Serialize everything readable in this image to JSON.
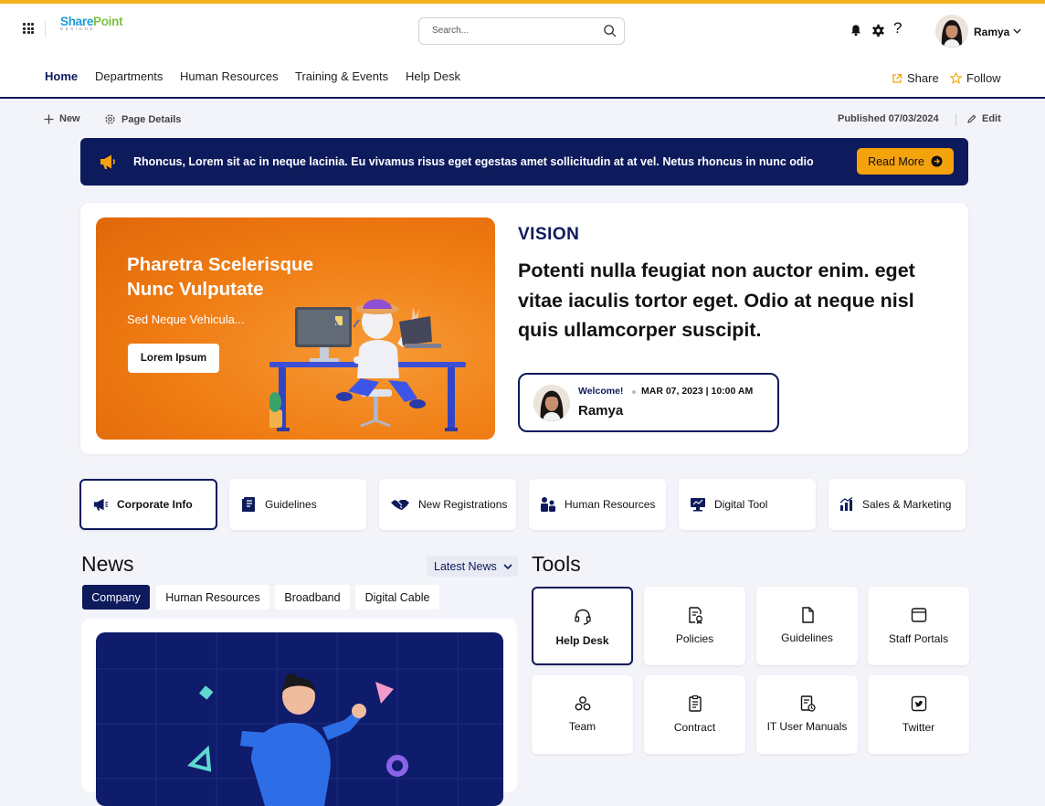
{
  "colors": {
    "accent": "#f5b31b",
    "navy": "#0d1a5c",
    "orange": "#ef7b12",
    "cta": "#f5a30d"
  },
  "header": {
    "logo": {
      "part1": "Share",
      "part2": "Point",
      "sub": "DESIGNS"
    },
    "search_placeholder": "Search...",
    "help_label": "?",
    "user_name": "Ramya"
  },
  "nav": {
    "items": [
      "Home",
      "Departments",
      "Human Resources",
      "Training & Events",
      "Help Desk"
    ],
    "share_label": "Share",
    "follow_label": "Follow"
  },
  "commandbar": {
    "new_label": "New",
    "page_details_label": "Page Details",
    "published": "Published 07/03/2024",
    "edit_label": "Edit"
  },
  "announcement": {
    "text": "Rhoncus, Lorem sit ac in neque lacinia. Eu vivamus risus eget egestas amet sollicitudin at at vel. Netus rhoncus in nunc odio",
    "button": "Read More"
  },
  "hero": {
    "banner_title": "Pharetra Scelerisque Nunc Vulputate",
    "banner_sub": "Sed Neque Vehicula...",
    "banner_button": "Lorem Ipsum",
    "vision_title": "VISION",
    "vision_text": "Potenti nulla feugiat non auctor enim. eget vitae iaculis tortor eget. Odio at neque nisl quis ullamcorper suscipit.",
    "welcome_label": "Welcome!",
    "welcome_date": "MAR 07, 2023 | 10:00 AM",
    "welcome_name": "Ramya"
  },
  "quicklinks": [
    {
      "label": "Corporate Info",
      "icon": "megaphone-icon"
    },
    {
      "label": "Guidelines",
      "icon": "document-icon"
    },
    {
      "label": "New Registrations",
      "icon": "handshake-icon"
    },
    {
      "label": "Human Resources",
      "icon": "people-icon"
    },
    {
      "label": "Digital Tool",
      "icon": "monitor-icon"
    },
    {
      "label": "Sales & Marketing",
      "icon": "bar-chart-icon"
    }
  ],
  "news": {
    "title": "News",
    "dropdown": "Latest News",
    "tabs": [
      "Company",
      "Human Resources",
      "Broadband",
      "Digital Cable"
    ]
  },
  "tools": {
    "title": "Tools",
    "items": [
      {
        "label": "Help Desk",
        "icon": "headset-icon"
      },
      {
        "label": "Policies",
        "icon": "policy-icon"
      },
      {
        "label": "Guidelines",
        "icon": "file-icon"
      },
      {
        "label": "Staff Portals",
        "icon": "portal-icon"
      },
      {
        "label": "Team",
        "icon": "team-icon"
      },
      {
        "label": "Contract",
        "icon": "clipboard-icon"
      },
      {
        "label": "IT User Manuals",
        "icon": "manual-icon"
      },
      {
        "label": "Twitter",
        "icon": "twitter-icon"
      }
    ]
  }
}
